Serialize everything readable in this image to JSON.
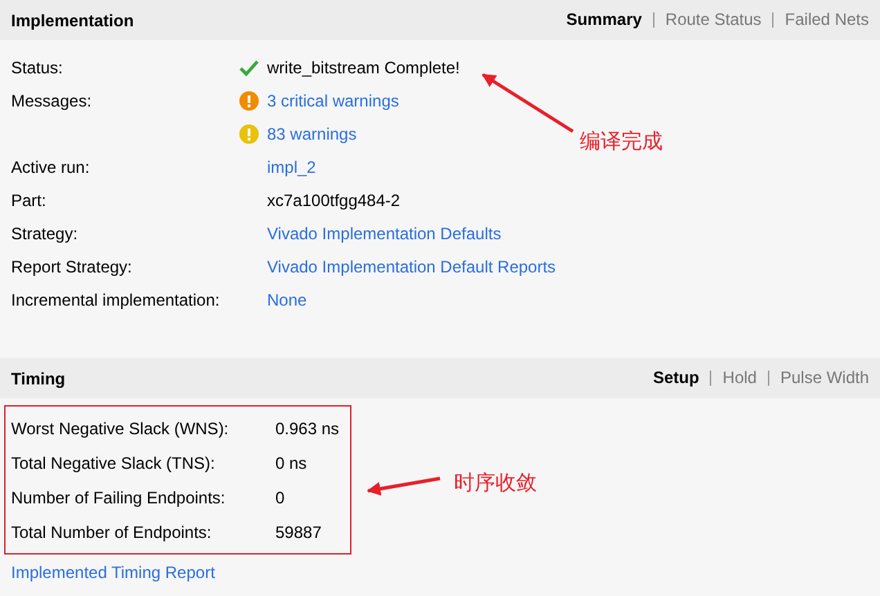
{
  "implementation": {
    "title": "Implementation",
    "tabs": [
      {
        "label": "Summary",
        "selected": true
      },
      {
        "label": "Route Status",
        "selected": false
      },
      {
        "label": "Failed Nets",
        "selected": false
      }
    ],
    "rows": [
      {
        "label": "Status:",
        "value": "write_bitstream Complete!",
        "kind": "status"
      },
      {
        "label": "Messages:",
        "value": "3 critical warnings",
        "kind": "critical"
      },
      {
        "value": "83 warnings",
        "kind": "warning"
      },
      {
        "label": "Active run:",
        "value": "impl_2",
        "kind": "link"
      },
      {
        "label": "Part:",
        "value": "xc7a100tfgg484-2",
        "kind": "text"
      },
      {
        "label": "Strategy:",
        "value": "Vivado Implementation Defaults",
        "kind": "link"
      },
      {
        "label": "Report Strategy:",
        "value": "Vivado Implementation Default Reports",
        "kind": "link"
      },
      {
        "label": "Incremental implementation:",
        "value": "None",
        "kind": "link"
      }
    ]
  },
  "timing": {
    "title": "Timing",
    "tabs": [
      {
        "label": "Setup",
        "selected": true
      },
      {
        "label": "Hold",
        "selected": false
      },
      {
        "label": "Pulse Width",
        "selected": false
      }
    ],
    "highlighted": true,
    "rows": [
      {
        "label": "Worst Negative Slack (WNS):",
        "value": "0.963 ns"
      },
      {
        "label": "Total Negative Slack (TNS):",
        "value": "0 ns"
      },
      {
        "label": "Number of Failing Endpoints:",
        "value": "0"
      },
      {
        "label": "Total Number of Endpoints:",
        "value": "59887"
      }
    ],
    "report_link": "Implemented Timing Report"
  },
  "annotations": [
    {
      "text": "编译完成"
    },
    {
      "text": "时序收敛"
    }
  ]
}
